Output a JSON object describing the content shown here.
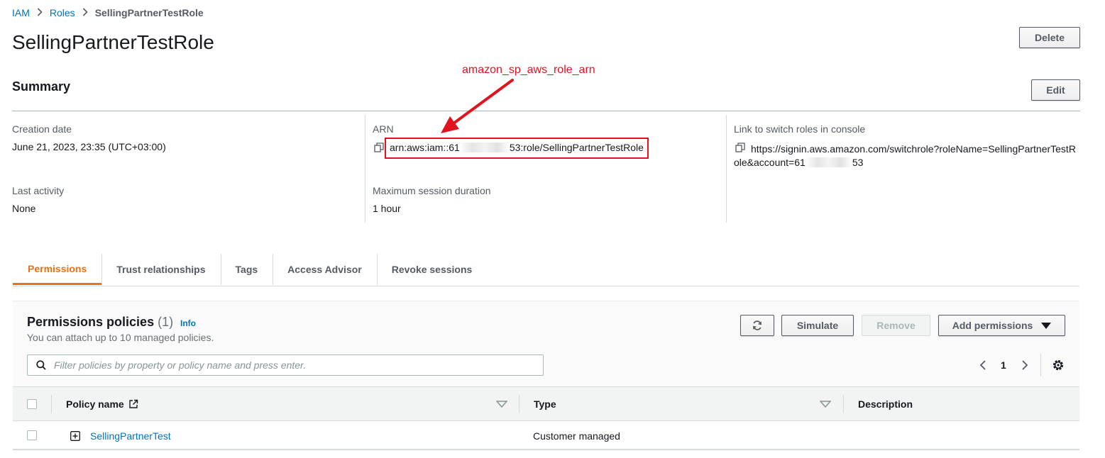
{
  "breadcrumb": {
    "iam": "IAM",
    "roles": "Roles",
    "current": "SellingPartnerTestRole"
  },
  "page_title": "SellingPartnerTestRole",
  "buttons": {
    "delete": "Delete",
    "edit": "Edit",
    "simulate": "Simulate",
    "remove": "Remove",
    "add_permissions": "Add permissions"
  },
  "summary": {
    "title": "Summary",
    "creation_date_label": "Creation date",
    "creation_date_value": "June 21, 2023, 23:35 (UTC+03:00)",
    "arn_label": "ARN",
    "arn_prefix": "arn:aws:iam::61",
    "arn_suffix": "53:role/SellingPartnerTestRole",
    "switch_label": "Link to switch roles in console",
    "switch_line1": "https://signin.aws.amazon.com/switchrole?roleName=SellingPartnerTestR",
    "switch_line2_prefix": "ole&account=61",
    "switch_line2_suffix": "53",
    "last_activity_label": "Last activity",
    "last_activity_value": "None",
    "max_session_label": "Maximum session duration",
    "max_session_value": "1 hour"
  },
  "annotation": "amazon_sp_aws_role_arn",
  "annotation_color": "#e0131f",
  "tabs": [
    "Permissions",
    "Trust relationships",
    "Tags",
    "Access Advisor",
    "Revoke sessions"
  ],
  "active_tab_color": "#ec7211",
  "permissions": {
    "title": "Permissions policies",
    "count": "(1)",
    "info": "Info",
    "subtitle": "You can attach up to 10 managed policies.",
    "search_placeholder": "Filter policies by property or policy name and press enter.",
    "page": "1"
  },
  "table": {
    "headers": {
      "policy_name": "Policy name",
      "type": "Type",
      "description": "Description"
    },
    "rows": [
      {
        "policy_name": "SellingPartnerTest",
        "type": "Customer managed",
        "description": ""
      }
    ]
  },
  "icons": [
    "chevron-right-icon",
    "copy-icon",
    "external-link-icon",
    "refresh-icon",
    "caret-down-icon",
    "search-icon",
    "chevron-left-icon",
    "settings-icon",
    "sort-icon",
    "expand-icon",
    "arrow-icon"
  ]
}
